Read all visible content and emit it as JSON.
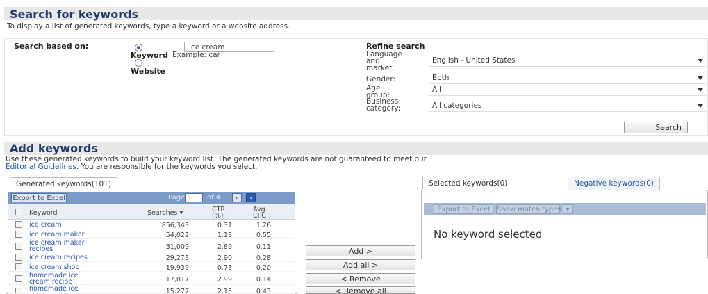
{
  "search_header": {
    "title": "Search for keywords",
    "description": "To display a list of generated keywords, type a keyword or a website address."
  },
  "search_form": {
    "based_on_label": "Search based on:",
    "keyword_option_label": "Keyword",
    "keyword_value": "ice cream",
    "keyword_hint": "Example: car",
    "website_option_label": "Website"
  },
  "refine": {
    "title": "Refine search",
    "language_label": "Language and market:",
    "language_value": "English - United States",
    "gender_label": "Gender:",
    "gender_value": "Both",
    "age_label": "Age group:",
    "age_value": "All",
    "business_label": "Business category:",
    "business_value": "All categories",
    "search_button": "Search"
  },
  "add_header": {
    "title": "Add keywords",
    "description_line1": "Use these generated keywords to build your keyword list. The generated keywords are not guaranteed to meet our",
    "description_link": "Editorial Guidelines",
    "description_line2": ". You are responsible for the keywords you select."
  },
  "generated": {
    "tab_label": "Generated keywords(101)",
    "export_button": "Export to Excel",
    "page_label": "Page",
    "page_value": "1",
    "of_label": "of 4",
    "columns": {
      "keyword": "Keyword",
      "searches": "Searches ▾",
      "ctr": "CTR (%)",
      "cpc": "Avg. CPC"
    },
    "rows": [
      {
        "keyword": "ice cream",
        "searches": "856,343",
        "ctr": "0.31",
        "cpc": "1.26"
      },
      {
        "keyword": "ice cream maker",
        "searches": "54,022",
        "ctr": "1.18",
        "cpc": "0.55"
      },
      {
        "keyword": "ice cream maker recipes",
        "searches": "31,009",
        "ctr": "2.89",
        "cpc": "0.11"
      },
      {
        "keyword": "ice cream recipes",
        "searches": "29,273",
        "ctr": "2.90",
        "cpc": "0.28"
      },
      {
        "keyword": "ice cream shop",
        "searches": "19,939",
        "ctr": "0.73",
        "cpc": "0.20"
      },
      {
        "keyword": "homemade ice cream recipe",
        "searches": "17,817",
        "ctr": "2.99",
        "cpc": "0.14"
      },
      {
        "keyword": "homemade ice cream",
        "searches": "15,277",
        "ctr": "2.15",
        "cpc": "0.43"
      }
    ]
  },
  "actions": {
    "add": "Add >",
    "add_all": "Add all >",
    "remove": "< Remove",
    "remove_all": "< Remove all"
  },
  "selected": {
    "tab_selected": "Selected keywords(0)",
    "tab_negative": "Negative keywords(0)",
    "export_button": "Export to Excel",
    "match_types_button": "Show match types",
    "empty_message": "No keyword selected"
  },
  "colors": {
    "header_title": "#1f3a6b",
    "toolbar": "#7a9bc7",
    "link": "#2a56a4"
  }
}
